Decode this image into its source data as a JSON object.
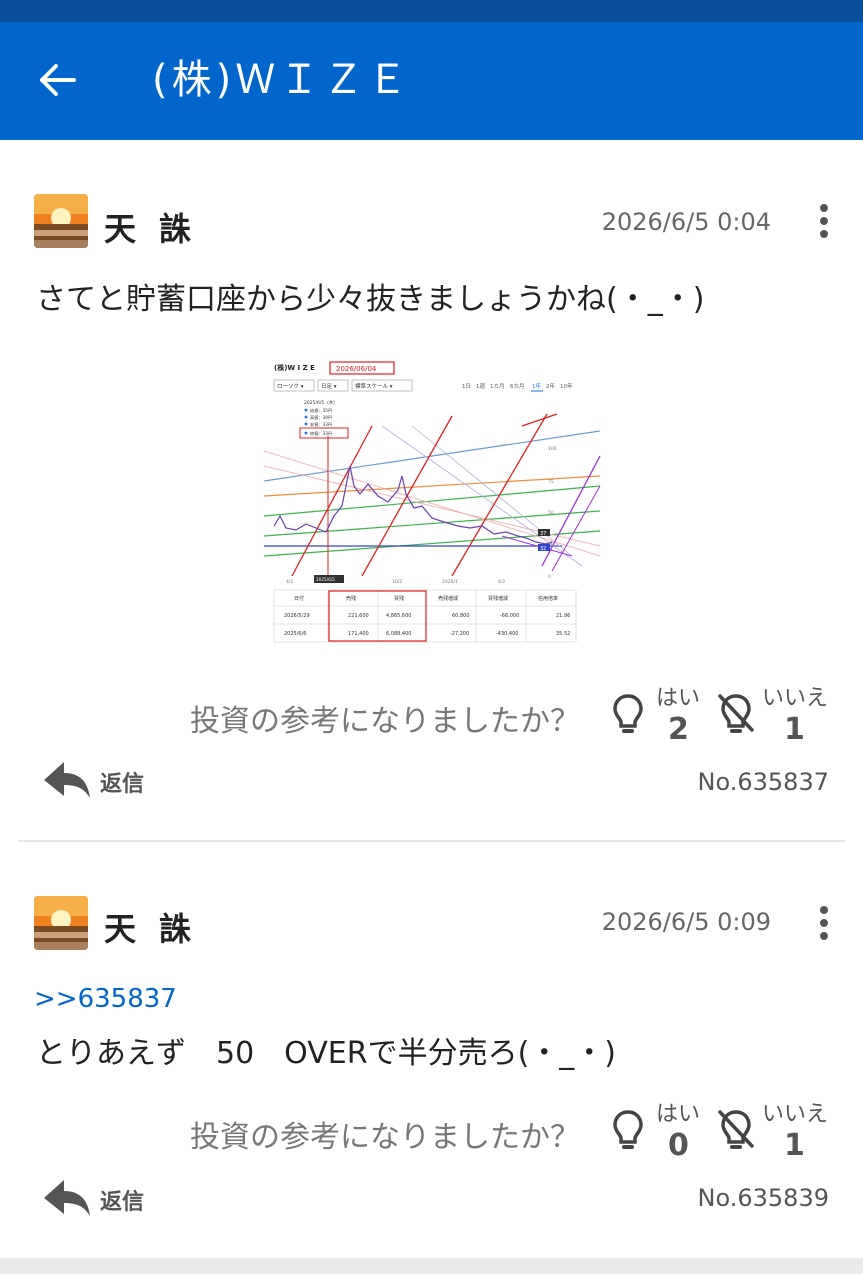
{
  "header": {
    "back_icon": "arrow-left-icon",
    "title": "(株)ＷＩＺＥ"
  },
  "colors": {
    "appbar": "#0066cc",
    "statusbar": "#0a4f9e",
    "link": "#0066cc"
  },
  "posts": [
    {
      "username": "天 誅",
      "timestamp": "2026/6/5 0:04",
      "body": "さてと貯蓄口座から少々抜きましょうかね(・_・)",
      "reply_to": "",
      "has_image": true,
      "question": "投資の参考になりましたか？",
      "yes_label": "はい",
      "yes_count": "2",
      "no_label": "いいえ",
      "no_count": "1",
      "reply_label": "返信",
      "post_number": "No.635837"
    },
    {
      "username": "天 誅",
      "timestamp": "2026/6/5 0:09",
      "body": "とりあえず　50　OVERで半分売ろ(・_・)",
      "reply_to": ">>635837",
      "has_image": false,
      "question": "投資の参考になりましたか？",
      "yes_label": "はい",
      "yes_count": "0",
      "no_label": "いいえ",
      "no_count": "1",
      "reply_label": "返信",
      "post_number": "No.635839"
    }
  ],
  "chart_image": {
    "title": "(株)W I Z E",
    "date_box": "2026/06/04",
    "controls": [
      "ローソク ▾",
      "日足 ▾",
      "標準スケール ▾"
    ],
    "periods": [
      "1日",
      "1週",
      "1カ月",
      "6カ月",
      "1年",
      "2年",
      "10年"
    ],
    "legend_date": "2025/6/5（木）",
    "legend": [
      "始値：35円",
      "高値：39円",
      "安値：33円",
      "終値：33円"
    ],
    "y_ticks": [
      "100",
      "75",
      "50",
      "25",
      "0"
    ],
    "x_ticks": [
      "4/2",
      "2025/6/5",
      "10/2",
      "2026/1",
      "4/2"
    ],
    "price_tags": [
      "37",
      "32"
    ],
    "table": {
      "headers": [
        "日付",
        "売残",
        "買残",
        "売残増減",
        "買残増減",
        "信用倍率"
      ],
      "rows": [
        [
          "2026/5/29",
          "221,600",
          "4,865,600",
          "60,800",
          "-66,000",
          "21.96"
        ],
        [
          "2025/6/6",
          "171,400",
          "6,088,400",
          "-27,200",
          "-430,400",
          "35.52"
        ]
      ]
    }
  }
}
